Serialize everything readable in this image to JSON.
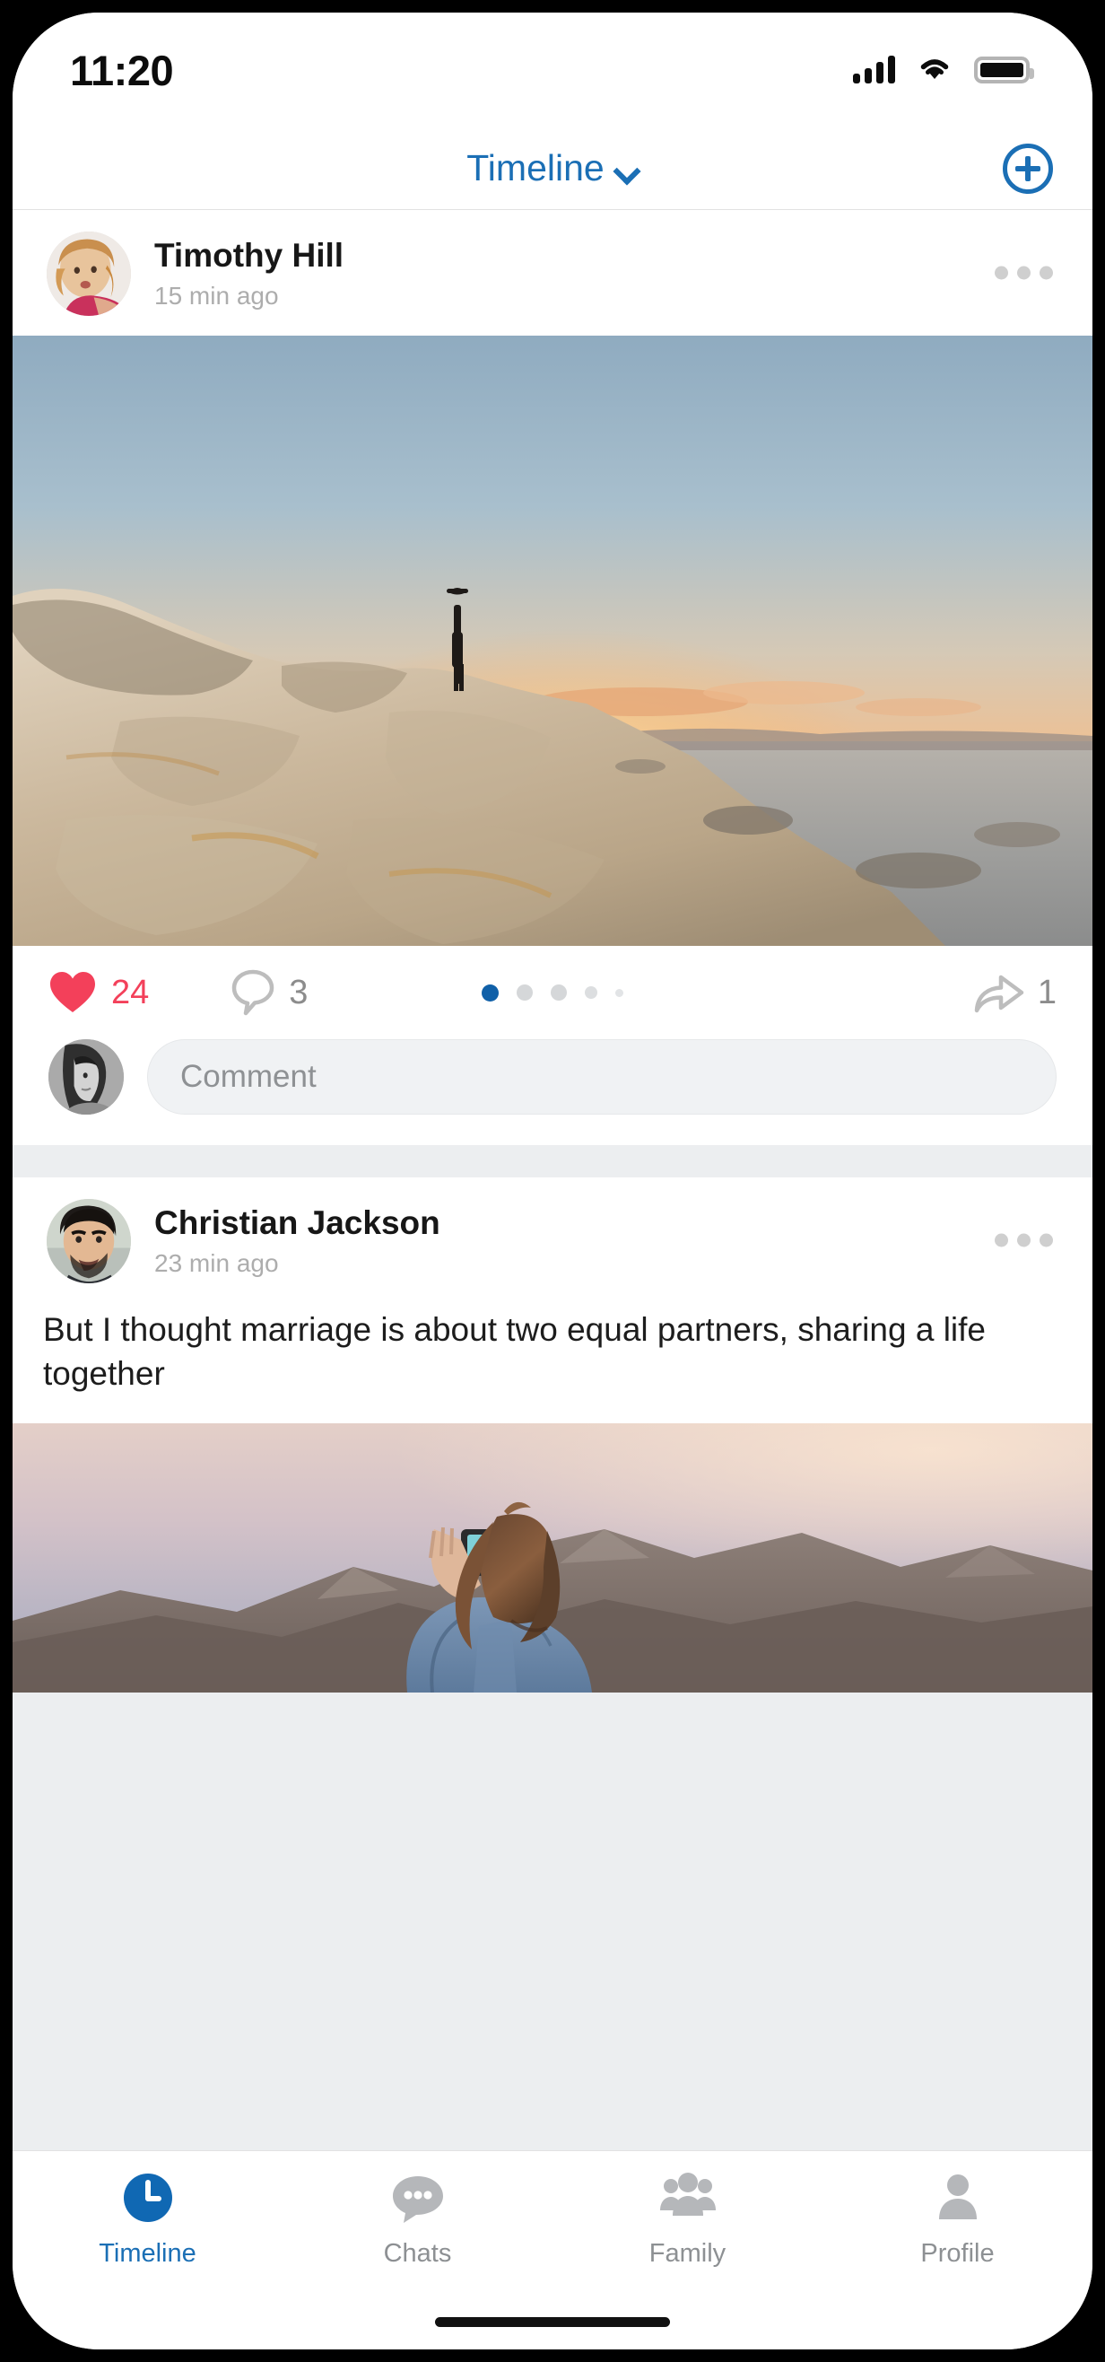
{
  "status_bar": {
    "time": "11:20",
    "signal_icon": "cellular-signal-icon",
    "wifi_icon": "wifi-icon",
    "battery_icon": "battery-full-icon"
  },
  "nav": {
    "title": "Timeline",
    "chevron_icon": "chevron-down-icon",
    "add_icon": "plus-circle-icon"
  },
  "posts": [
    {
      "author": "Timothy Hill",
      "time": "15 min ago",
      "more_icon": "more-horizontal-icon",
      "text": "",
      "media": "sunset-cliff-photo",
      "actions": {
        "like_icon": "heart-filled-icon",
        "like_count": "24",
        "comment_icon": "comment-bubble-icon",
        "comment_count": "3",
        "share_icon": "share-arrow-icon",
        "share_count": "1",
        "page_dots": 5,
        "active_dot": 0
      },
      "comment_box": {
        "avatar": "user-avatar",
        "placeholder": "Comment"
      }
    },
    {
      "author": "Christian Jackson",
      "time": "23 min ago",
      "more_icon": "more-horizontal-icon",
      "text": "But I thought marriage is about two equal partners, sharing a life together",
      "media": "woman-photographing-mountains-photo"
    }
  ],
  "tabs": [
    {
      "label": "Timeline",
      "icon": "clock-icon",
      "active": true
    },
    {
      "label": "Chats",
      "icon": "chat-bubble-icon",
      "active": false
    },
    {
      "label": "Family",
      "icon": "people-group-icon",
      "active": false
    },
    {
      "label": "Profile",
      "icon": "person-icon",
      "active": false
    }
  ],
  "colors": {
    "accent": "#1b6fb5",
    "like": "#f3405a",
    "muted": "#8d9093",
    "surface": "#ffffff",
    "feed_bg": "#eceef0"
  }
}
